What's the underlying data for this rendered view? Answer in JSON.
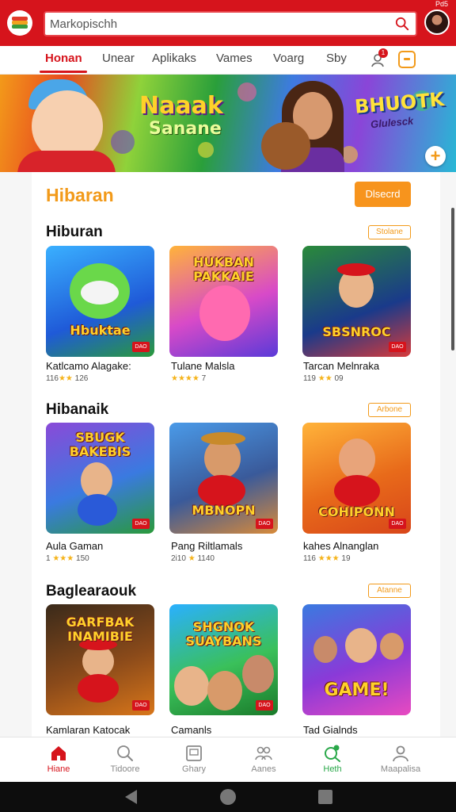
{
  "status": {
    "text": "Pd5"
  },
  "search": {
    "value": "Markopischh"
  },
  "tabs": [
    {
      "label": "Honan"
    },
    {
      "label": "Unear"
    },
    {
      "label": "Aplikaks"
    },
    {
      "label": "Vames"
    },
    {
      "label": "Voarg"
    },
    {
      "label": "Sby"
    }
  ],
  "notification": {
    "count": "1"
  },
  "banner": {
    "title": "Naaak",
    "subtitle": "Sanane",
    "right_title": "BHUOTK",
    "right_subtitle": "Glulesck"
  },
  "hero": {
    "title": "Hibaran",
    "button": "Dlsecrd"
  },
  "sections": [
    {
      "title": "Hiburan",
      "pill": "Stolane",
      "games": [
        {
          "name": "Katlcamo Alagake:",
          "rating": "116",
          "rating_tail": "126",
          "art_title": "Hbuktae",
          "tag": "DAO"
        },
        {
          "name": "Tulane Malsla",
          "rating": "",
          "rating_tail": "7",
          "art_title": "HUKBAN PAKKAIE",
          "tag": ""
        },
        {
          "name": "Tarcan Melnraka",
          "rating": "119",
          "rating_tail": "09",
          "art_title": "SBSNROC",
          "tag": "DAO"
        }
      ]
    },
    {
      "title": "Hibanaik",
      "pill": "Arbone",
      "games": [
        {
          "name": "Aula Gaman",
          "rating": "1",
          "rating_tail": "150",
          "art_title": "SBUGK BAKEBIS",
          "tag": "DAO"
        },
        {
          "name": "Pang Riltlamals",
          "rating": "2i10",
          "rating_tail": "1140",
          "art_title": "MBNOPN",
          "tag": "DAO"
        },
        {
          "name": "kahes Alnanglan",
          "rating": "116",
          "rating_tail": "19",
          "art_title": "COHIPONN",
          "tag": "DAO"
        }
      ]
    },
    {
      "title": "Baglearaouk",
      "pill": "Atanne",
      "games": [
        {
          "name": "Kamlaran Katocak",
          "rating": "",
          "rating_tail": "",
          "art_title": "GARFBAK INAMIBIE",
          "tag": "DAO"
        },
        {
          "name": "Camanls",
          "rating": "",
          "rating_tail": "",
          "art_title": "SHGNOK SUAYBANS",
          "tag": "DAO"
        },
        {
          "name": "Tad Gialnds",
          "rating": "",
          "rating_tail": "",
          "art_title": "GAME!",
          "tag": ""
        }
      ]
    }
  ],
  "bottom_nav": [
    {
      "label": "Hiane",
      "icon": "home-icon"
    },
    {
      "label": "Tidoore",
      "icon": "search-icon"
    },
    {
      "label": "Ghary",
      "icon": "gallery-icon"
    },
    {
      "label": "Aanes",
      "icon": "people-icon"
    },
    {
      "label": "Heth",
      "icon": "discover-icon"
    },
    {
      "label": "Maapalisa",
      "icon": "profile-icon"
    }
  ],
  "colors": {
    "brand": "#d6141c",
    "accent": "#f7941d"
  }
}
